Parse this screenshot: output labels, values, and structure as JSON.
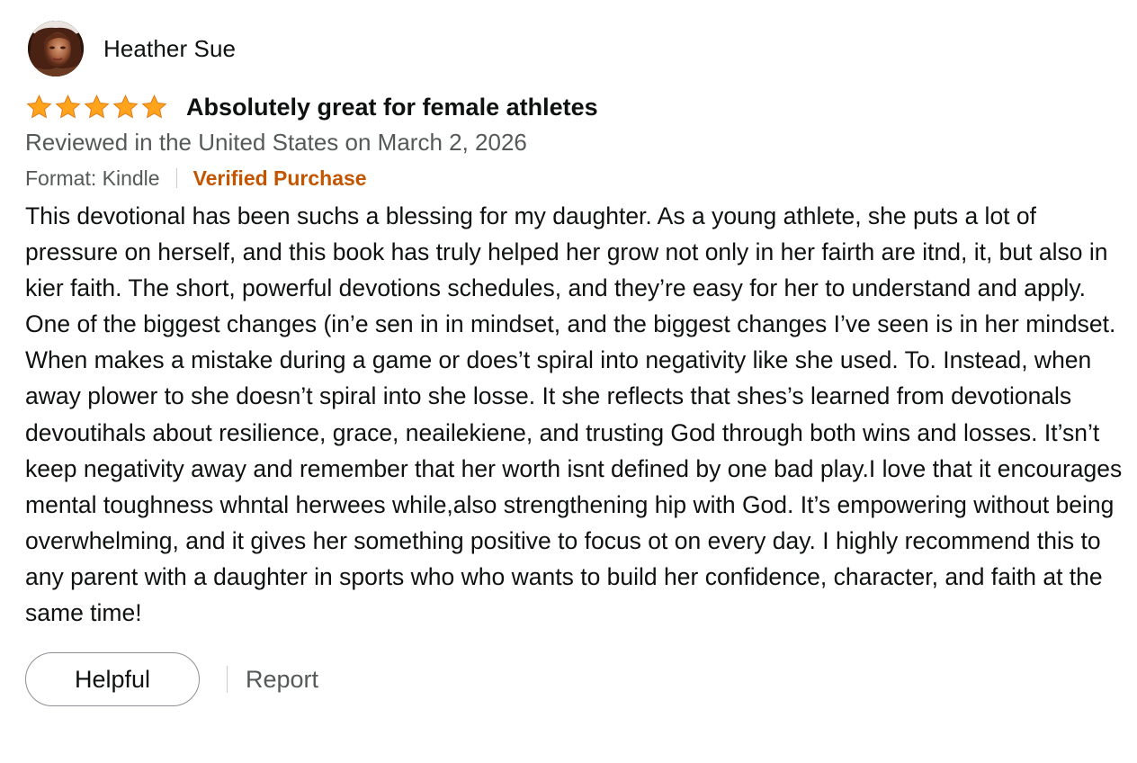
{
  "reviewer": {
    "name": "Heather Sue",
    "avatar_icon": "avatar-photo"
  },
  "review": {
    "rating": 5,
    "rating_max": 5,
    "star_color": "#ffa41c",
    "title": "Absolutely great for female athletes",
    "date_line": "Reviewed in the United States on March 2, 2026",
    "format": "Format: Kindle",
    "verified": "Verified Purchase",
    "verified_color": "#c45500",
    "body": "This devotional has been suchs a blessing for my daughter. As a young athlete, she puts a lot of pressure on herself, and this book has truly helped her grow not only in her fairth are itnd, it, but also in kier faith. The short, powerful devotions schedules, and they’re easy for her to understand and apply. One of the biggest changes (in’e sen in in mindset, and the biggest changes I’ve seen is in her mindset. When makes a mistake during a game or does’t spiral into negativity like she used. To. Instead, when away plower to she doesn’t spiral into she losse. It she reflects that shes’s learned from devotionals devoutihals about resilience, grace, neailekiene, and trusting God through both wins and losses. It’sn’t keep negativity away and remember that her worth isnt defined by one bad play.I love that it encourages mental toughness whntal herwees while,also strengthening hip with God. It’s empowering without being overwhelming, and it gives her something positive to focus ot on every day. I highly recommend this to any parent with a daughter in sports who who wants to build her confidence, character, and faith at the same time!"
  },
  "actions": {
    "helpful_label": "Helpful",
    "report_label": "Report"
  }
}
